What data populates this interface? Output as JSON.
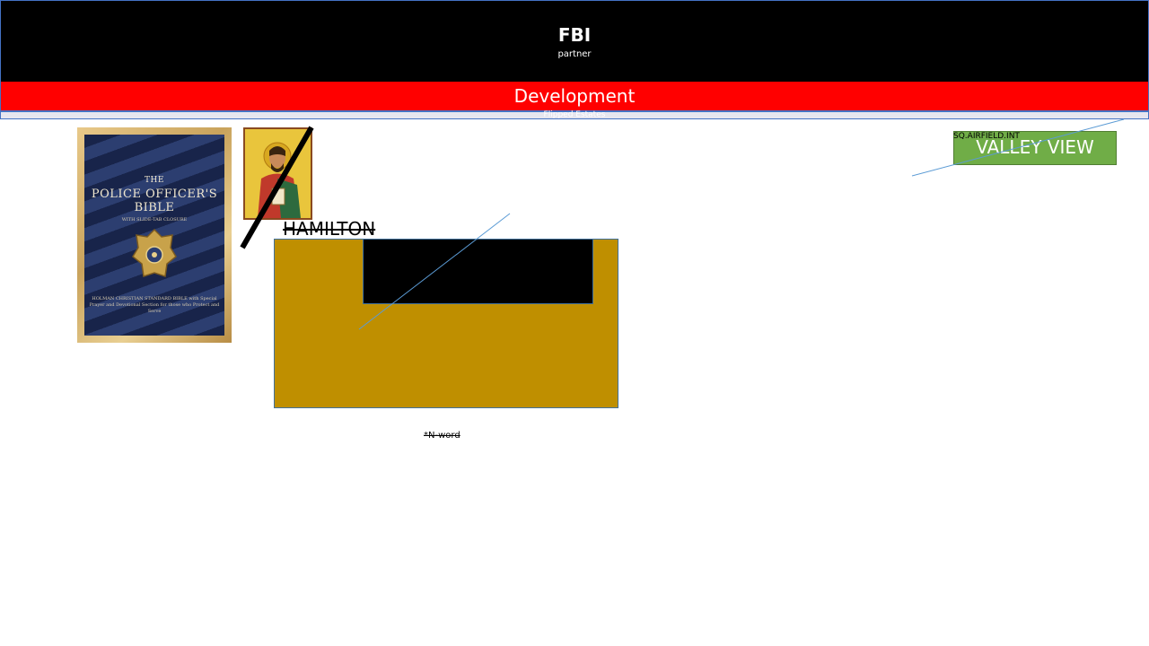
{
  "header": {
    "title": "FBI",
    "subtitle": "partner"
  },
  "development_bar": {
    "label": "Development",
    "strip_text": "Flipped Estates"
  },
  "book": {
    "title_line1": "THE",
    "title_line2": "POLICE OFFICER'S",
    "title_line3": "BIBLE",
    "subtitle": "WITH SLIDE-TAB CLOSURE",
    "badge_text": "POLICE OFFICER",
    "footer": "HOLMAN CHRISTIAN STANDARD BIBLE with Special Prayer and Devotional Section for those who Protect and Serve"
  },
  "labels": {
    "hamilton": "HAMILTON",
    "nword": "*N-word",
    "airfield": "SQ.AIRFIELD.INT",
    "valley_view": "VALLEY VIEW"
  },
  "colors": {
    "header_bg": "#000000",
    "dev_bar_bg": "#ff0000",
    "gold_box": "#bf8f00",
    "valley_box": "#70ad47",
    "line_color": "#5b9bd5",
    "outline": "#4472c4"
  }
}
